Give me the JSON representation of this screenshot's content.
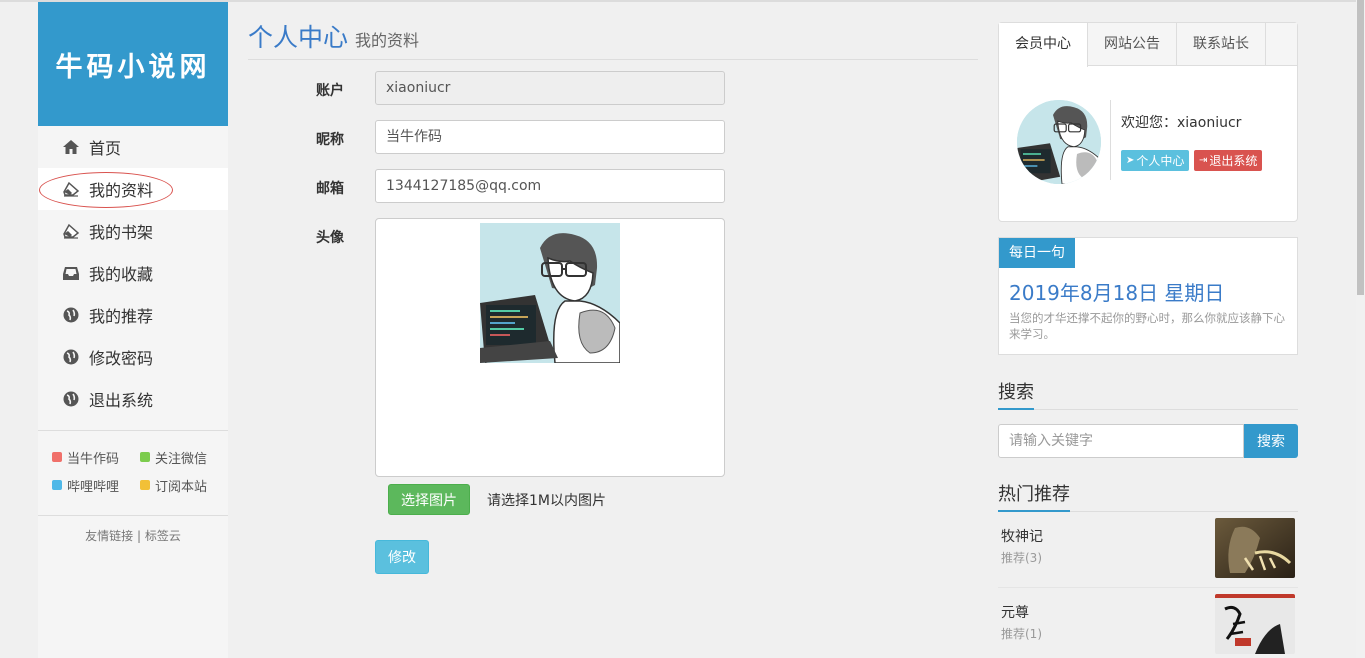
{
  "site": {
    "logo_text": "牛码小说网"
  },
  "sidebar": {
    "items": [
      {
        "label": "首页",
        "icon": "home-icon"
      },
      {
        "label": "我的资料",
        "icon": "eraser-icon"
      },
      {
        "label": "我的书架",
        "icon": "eraser-icon"
      },
      {
        "label": "我的收藏",
        "icon": "inbox-icon"
      },
      {
        "label": "我的推荐",
        "icon": "globe-icon"
      },
      {
        "label": "修改密码",
        "icon": "globe-icon"
      },
      {
        "label": "退出系统",
        "icon": "globe-icon"
      }
    ],
    "links": [
      {
        "label": "当牛作码",
        "color": "#f0706a"
      },
      {
        "label": "关注微信",
        "color": "#7ccc4d"
      },
      {
        "label": "哔哩哔哩",
        "color": "#4fb8e8"
      },
      {
        "label": "订阅本站",
        "color": "#f2c037"
      }
    ],
    "friend_links": "友情链接 | 标签云"
  },
  "main": {
    "title": "个人中心",
    "subtitle": "我的资料",
    "account_label": "账户",
    "account_value": "xiaoniucr",
    "nickname_label": "昵称",
    "nickname_value": "当牛作码",
    "email_label": "邮箱",
    "email_value": "1344127185@qq.com",
    "avatar_label": "头像",
    "select_image_btn": "选择图片",
    "image_hint": "请选择1M以内图片",
    "submit_btn": "修改"
  },
  "right": {
    "tabs": [
      "会员中心",
      "网站公告",
      "联系站长"
    ],
    "welcome": "欢迎您：xiaoniucr",
    "user_center_btn": "个人中心",
    "logout_btn": "退出系统",
    "daily_tag": "每日一句",
    "daily_date": "2019年8月18日 星期日",
    "daily_quote": "当您的才华还撑不起你的野心时，那么你就应该静下心来学习。",
    "search_title": "搜索",
    "search_placeholder": "请输入关键字",
    "search_btn": "搜索",
    "hot_title": "热门推荐",
    "hot_items": [
      {
        "name": "牧神记",
        "rec": "推荐(3)"
      },
      {
        "name": "元尊",
        "rec": "推荐(1)"
      }
    ]
  },
  "colors": {
    "brand": "#3399cc",
    "success": "#5cb85c",
    "info": "#5bc0de",
    "danger": "#d9534f"
  }
}
